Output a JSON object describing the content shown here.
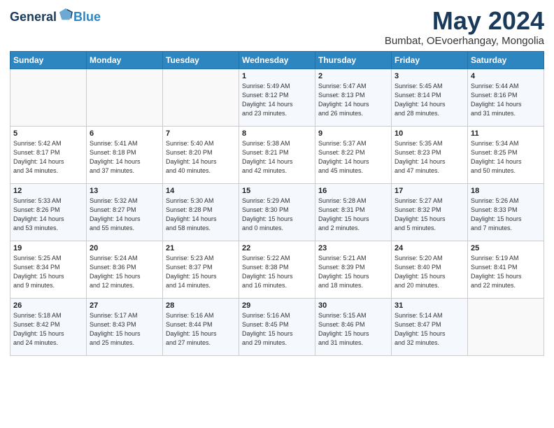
{
  "logo": {
    "general": "General",
    "blue": "Blue"
  },
  "header": {
    "month_year": "May 2024",
    "location": "Bumbat, OEvoerhangay, Mongolia"
  },
  "weekdays": [
    "Sunday",
    "Monday",
    "Tuesday",
    "Wednesday",
    "Thursday",
    "Friday",
    "Saturday"
  ],
  "weeks": [
    [
      {
        "day": "",
        "info": ""
      },
      {
        "day": "",
        "info": ""
      },
      {
        "day": "",
        "info": ""
      },
      {
        "day": "1",
        "info": "Sunrise: 5:49 AM\nSunset: 8:12 PM\nDaylight: 14 hours\nand 23 minutes."
      },
      {
        "day": "2",
        "info": "Sunrise: 5:47 AM\nSunset: 8:13 PM\nDaylight: 14 hours\nand 26 minutes."
      },
      {
        "day": "3",
        "info": "Sunrise: 5:45 AM\nSunset: 8:14 PM\nDaylight: 14 hours\nand 28 minutes."
      },
      {
        "day": "4",
        "info": "Sunrise: 5:44 AM\nSunset: 8:16 PM\nDaylight: 14 hours\nand 31 minutes."
      }
    ],
    [
      {
        "day": "5",
        "info": "Sunrise: 5:42 AM\nSunset: 8:17 PM\nDaylight: 14 hours\nand 34 minutes."
      },
      {
        "day": "6",
        "info": "Sunrise: 5:41 AM\nSunset: 8:18 PM\nDaylight: 14 hours\nand 37 minutes."
      },
      {
        "day": "7",
        "info": "Sunrise: 5:40 AM\nSunset: 8:20 PM\nDaylight: 14 hours\nand 40 minutes."
      },
      {
        "day": "8",
        "info": "Sunrise: 5:38 AM\nSunset: 8:21 PM\nDaylight: 14 hours\nand 42 minutes."
      },
      {
        "day": "9",
        "info": "Sunrise: 5:37 AM\nSunset: 8:22 PM\nDaylight: 14 hours\nand 45 minutes."
      },
      {
        "day": "10",
        "info": "Sunrise: 5:35 AM\nSunset: 8:23 PM\nDaylight: 14 hours\nand 47 minutes."
      },
      {
        "day": "11",
        "info": "Sunrise: 5:34 AM\nSunset: 8:25 PM\nDaylight: 14 hours\nand 50 minutes."
      }
    ],
    [
      {
        "day": "12",
        "info": "Sunrise: 5:33 AM\nSunset: 8:26 PM\nDaylight: 14 hours\nand 53 minutes."
      },
      {
        "day": "13",
        "info": "Sunrise: 5:32 AM\nSunset: 8:27 PM\nDaylight: 14 hours\nand 55 minutes."
      },
      {
        "day": "14",
        "info": "Sunrise: 5:30 AM\nSunset: 8:28 PM\nDaylight: 14 hours\nand 58 minutes."
      },
      {
        "day": "15",
        "info": "Sunrise: 5:29 AM\nSunset: 8:30 PM\nDaylight: 15 hours\nand 0 minutes."
      },
      {
        "day": "16",
        "info": "Sunrise: 5:28 AM\nSunset: 8:31 PM\nDaylight: 15 hours\nand 2 minutes."
      },
      {
        "day": "17",
        "info": "Sunrise: 5:27 AM\nSunset: 8:32 PM\nDaylight: 15 hours\nand 5 minutes."
      },
      {
        "day": "18",
        "info": "Sunrise: 5:26 AM\nSunset: 8:33 PM\nDaylight: 15 hours\nand 7 minutes."
      }
    ],
    [
      {
        "day": "19",
        "info": "Sunrise: 5:25 AM\nSunset: 8:34 PM\nDaylight: 15 hours\nand 9 minutes."
      },
      {
        "day": "20",
        "info": "Sunrise: 5:24 AM\nSunset: 8:36 PM\nDaylight: 15 hours\nand 12 minutes."
      },
      {
        "day": "21",
        "info": "Sunrise: 5:23 AM\nSunset: 8:37 PM\nDaylight: 15 hours\nand 14 minutes."
      },
      {
        "day": "22",
        "info": "Sunrise: 5:22 AM\nSunset: 8:38 PM\nDaylight: 15 hours\nand 16 minutes."
      },
      {
        "day": "23",
        "info": "Sunrise: 5:21 AM\nSunset: 8:39 PM\nDaylight: 15 hours\nand 18 minutes."
      },
      {
        "day": "24",
        "info": "Sunrise: 5:20 AM\nSunset: 8:40 PM\nDaylight: 15 hours\nand 20 minutes."
      },
      {
        "day": "25",
        "info": "Sunrise: 5:19 AM\nSunset: 8:41 PM\nDaylight: 15 hours\nand 22 minutes."
      }
    ],
    [
      {
        "day": "26",
        "info": "Sunrise: 5:18 AM\nSunset: 8:42 PM\nDaylight: 15 hours\nand 24 minutes."
      },
      {
        "day": "27",
        "info": "Sunrise: 5:17 AM\nSunset: 8:43 PM\nDaylight: 15 hours\nand 25 minutes."
      },
      {
        "day": "28",
        "info": "Sunrise: 5:16 AM\nSunset: 8:44 PM\nDaylight: 15 hours\nand 27 minutes."
      },
      {
        "day": "29",
        "info": "Sunrise: 5:16 AM\nSunset: 8:45 PM\nDaylight: 15 hours\nand 29 minutes."
      },
      {
        "day": "30",
        "info": "Sunrise: 5:15 AM\nSunset: 8:46 PM\nDaylight: 15 hours\nand 31 minutes."
      },
      {
        "day": "31",
        "info": "Sunrise: 5:14 AM\nSunset: 8:47 PM\nDaylight: 15 hours\nand 32 minutes."
      },
      {
        "day": "",
        "info": ""
      }
    ]
  ]
}
